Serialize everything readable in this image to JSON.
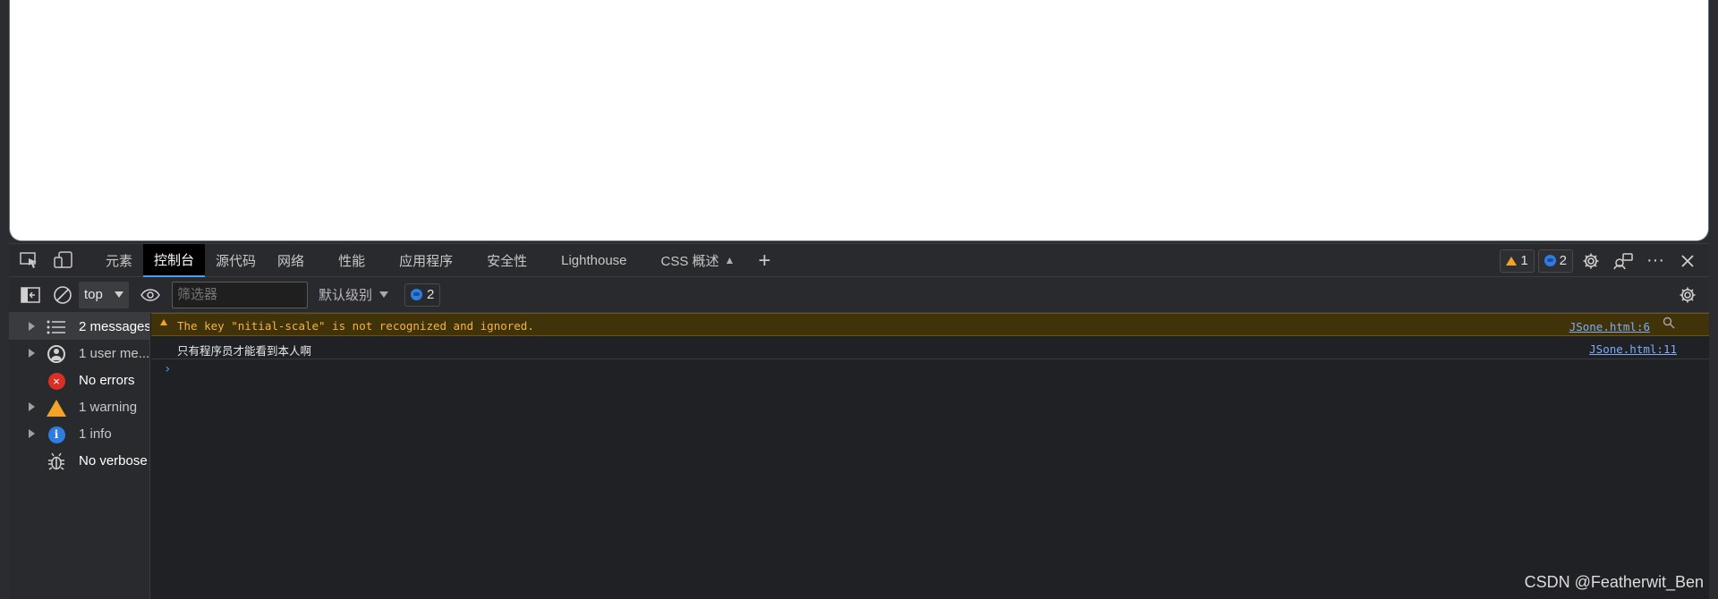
{
  "main_tabs": [
    {
      "label": "元素"
    },
    {
      "label": "控制台",
      "active": true
    },
    {
      "label": "源代码"
    },
    {
      "label": "网络"
    },
    {
      "label": "性能"
    },
    {
      "label": "应用程序"
    },
    {
      "label": "安全性"
    },
    {
      "label": "Lighthouse"
    },
    {
      "label": "CSS 概述"
    }
  ],
  "tabbar_right": {
    "warnings_count": "1",
    "messages_count": "2"
  },
  "console_toolbar": {
    "context": "top",
    "filter_placeholder": "筛选器",
    "level_label": "默认级别",
    "issues_count": "2"
  },
  "sidebar": {
    "items": [
      {
        "label": "2 messages",
        "icon": "list-icon"
      },
      {
        "label": "1 user me...",
        "icon": "user-icon"
      },
      {
        "label": "No errors",
        "icon": "error-icon"
      },
      {
        "label": "1 warning",
        "icon": "warning-icon"
      },
      {
        "label": "1 info",
        "icon": "info-icon"
      },
      {
        "label": "No verbose",
        "icon": "bug-icon"
      }
    ]
  },
  "messages": [
    {
      "level": "warning",
      "text": "The key \"nitial-scale\" is not recognized and ignored.",
      "source": "JSone.html:6"
    },
    {
      "level": "log",
      "text": "只有程序员才能看到本人啊",
      "source": "JSone.html:11"
    }
  ],
  "prompt_symbol": "›",
  "watermark": "CSDN @Featherwit_Ben",
  "colors": {
    "accent": "#4d9cf5",
    "warning": "#f3a428",
    "error": "#d93025",
    "info": "#2f7de1"
  }
}
